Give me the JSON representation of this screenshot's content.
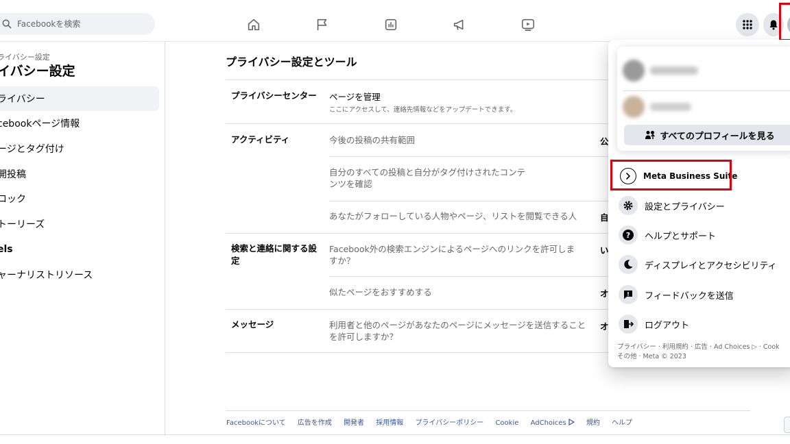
{
  "search": {
    "placeholder": "Facebookを検索"
  },
  "nav": {
    "icons": [
      "home-icon",
      "flag-icon",
      "insights-icon",
      "megaphone-icon",
      "video-icon"
    ]
  },
  "header_right": {
    "icons": [
      "menu-grid-icon",
      "bell-icon",
      "account-avatar"
    ]
  },
  "sidebar": {
    "breadcrumb": "ライバシー設定",
    "title": "イバシー設定",
    "items": [
      {
        "label": "ライバシー",
        "active": true
      },
      {
        "label": "cebookページ情報"
      },
      {
        "label": "ージとタグ付け"
      },
      {
        "label": "開投稿"
      },
      {
        "label": "ロック"
      },
      {
        "label": "トーリーズ"
      },
      {
        "label": "els",
        "bold": true
      },
      {
        "label": "ャーナリストリソース"
      }
    ]
  },
  "main": {
    "title": "プライバシー設定とツール",
    "sections": [
      {
        "label": "プライバシーセンター",
        "rows": [
          {
            "text": "ページを管理",
            "sub": "ここにアクセスして、連絡先情報などをアップデートできます。"
          }
        ]
      },
      {
        "label": "アクティビティ",
        "rows": [
          {
            "text": "今後の投稿の共有範囲",
            "value": "公"
          },
          {
            "text": "自分のすべての投稿と自分がタグ付けされたコンテンツを確認"
          },
          {
            "text": "あなたがフォローしている人物やページ、リストを閲覧できる人",
            "value": "自"
          }
        ]
      },
      {
        "label": "検索と連絡に関する設定",
        "rows": [
          {
            "text": "Facebook外の検索エンジンによるページへのリンクを許可しますか？",
            "value": "い"
          },
          {
            "text": "似たページをおすすめする",
            "value": "オ"
          }
        ]
      },
      {
        "label": "メッセージ",
        "rows": [
          {
            "text": "利用者と他のページがあなたのページにメッセージを送信することを許可しますか？",
            "value": "オ"
          }
        ]
      }
    ]
  },
  "footer": {
    "links": [
      "Facebookについて",
      "広告を作成",
      "開発者",
      "採用情報",
      "プライバシーポリシー",
      "Cookie",
      "AdChoices",
      "規約",
      "ヘルプ"
    ]
  },
  "dropdown": {
    "see_all_profiles": "すべてのプロフィールを見る",
    "menu": [
      {
        "label": "Meta Business Suite",
        "icon": "business-suite-icon",
        "bold": true
      },
      {
        "label": "設定とプライバシー",
        "icon": "gear-icon"
      },
      {
        "label": "ヘルプとサポート",
        "icon": "question-icon"
      },
      {
        "label": "ディスプレイとアクセシビリティ",
        "icon": "moon-icon"
      },
      {
        "label": "フィードバックを送信",
        "icon": "feedback-icon"
      },
      {
        "label": "ログアウト",
        "icon": "logout-icon"
      }
    ],
    "footer_line1": "プライバシー · 利用規約 · 広告 · Ad Choices ▷ · Cook",
    "footer_line2": "その他 · Meta © 2023"
  },
  "colors": {
    "highlight": "#e0000b",
    "link": "#385898",
    "muted": "#65676b"
  }
}
